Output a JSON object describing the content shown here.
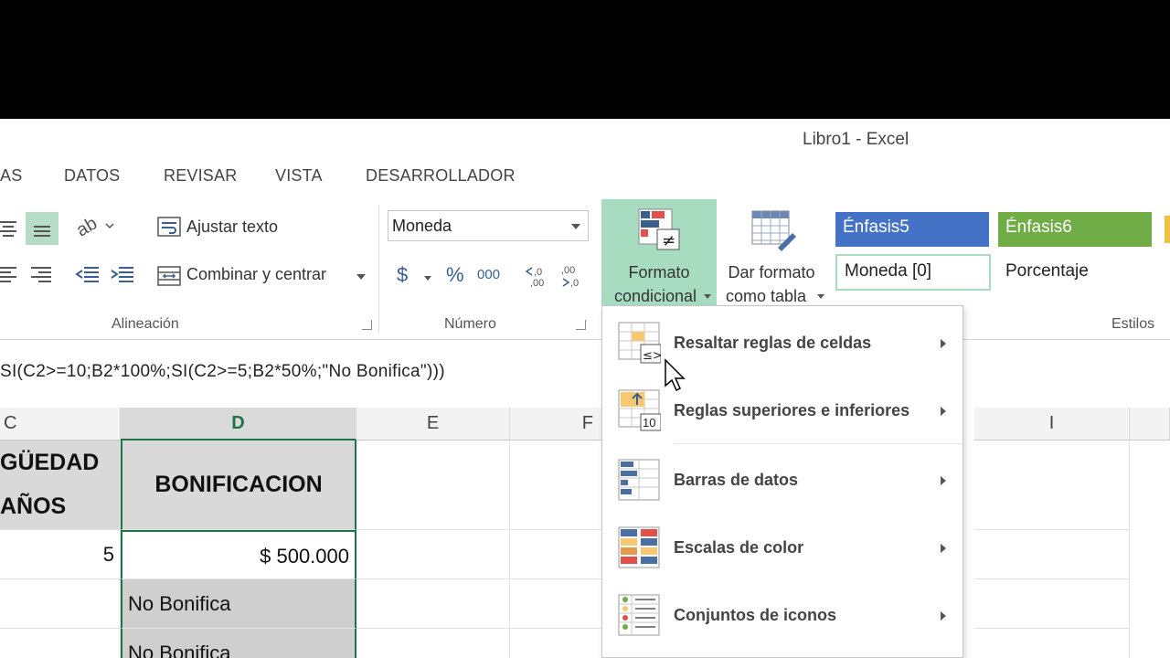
{
  "window": {
    "title": "Libro1 - Excel"
  },
  "tabs": [
    "AS",
    "DATOS",
    "REVISAR",
    "VISTA",
    "DESARROLLADOR"
  ],
  "ribbon": {
    "alignment": {
      "wrap_text": "Ajustar texto",
      "merge_center": "Combinar y centrar",
      "group_label": "Alineación"
    },
    "number": {
      "format_value": "Moneda",
      "currency_symbol": "$",
      "percent_symbol": "%",
      "thousands": "000",
      "group_label": "Número"
    },
    "styles": {
      "conditional_format_line1": "Formato",
      "conditional_format_line2": "condicional",
      "format_table_line1": "Dar formato",
      "format_table_line2": "como tabla",
      "cell_styles": [
        {
          "label": "Énfasis5",
          "bg": "#4472c4",
          "fg": "#ffffff"
        },
        {
          "label": "Énfasis6",
          "bg": "#70ad47",
          "fg": "#ffffff"
        },
        {
          "label": "Moneda [0]",
          "bg": "#ffffff",
          "fg": "#222222"
        },
        {
          "label": "Porcentaje",
          "bg": "#ffffff",
          "fg": "#222222"
        }
      ],
      "group_label": "Estilos"
    }
  },
  "formula_bar": {
    "formula": "SI(C2>=10;B2*100%;SI(C2>=5;B2*50%;\"No Bonifica\")))"
  },
  "grid": {
    "columns": [
      "C",
      "D",
      "E",
      "F",
      "I"
    ],
    "header_c_line1": "GÜEDAD",
    "header_c_line2": "AÑOS",
    "header_d": "BONIFICACION",
    "c_row2": "5",
    "d_row2": "$ 500.000",
    "d_row3": "No Bonifica",
    "d_row4": "No Bonifica"
  },
  "menu": {
    "items": [
      {
        "label": "Resaltar reglas de celdas",
        "icon": "highlight-rules-icon"
      },
      {
        "label": "Reglas superiores e inferiores",
        "icon": "top-bottom-rules-icon",
        "icon_text": "10"
      },
      {
        "label": "Barras de datos",
        "icon": "data-bars-icon"
      },
      {
        "label": "Escalas de color",
        "icon": "color-scales-icon"
      },
      {
        "label": "Conjuntos de iconos",
        "icon": "icon-sets-icon"
      }
    ]
  },
  "colors": {
    "accent_green": "#217346",
    "cf_highlight": "#a8dcc0"
  }
}
